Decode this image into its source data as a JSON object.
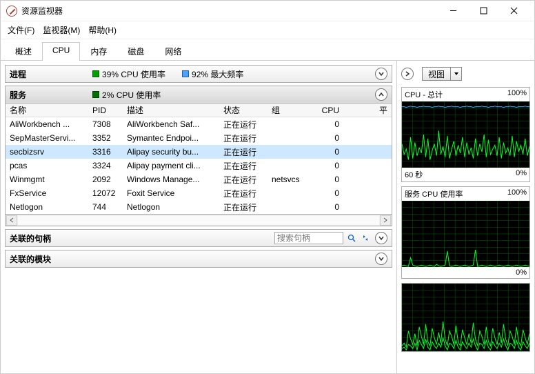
{
  "window": {
    "title": "资源监视器"
  },
  "menu": {
    "file": "文件(F)",
    "monitor": "监视器(M)",
    "help": "帮助(H)"
  },
  "tabs": {
    "overview": "概述",
    "cpu": "CPU",
    "memory": "内存",
    "disk": "磁盘",
    "network": "网络",
    "active": "cpu"
  },
  "process_panel": {
    "title": "进程",
    "cpu_text": "39% CPU 使用率",
    "freq_text": "92% 最大频率"
  },
  "services_panel": {
    "title": "服务",
    "cpu_text": "2% CPU 使用率",
    "columns": {
      "name": "名称",
      "pid": "PID",
      "desc": "描述",
      "status": "状态",
      "group": "组",
      "cpu": "CPU",
      "avg": "平"
    },
    "rows": [
      {
        "name": "AliWorkbench ...",
        "pid": "7308",
        "desc": "AliWorkbench Saf...",
        "status": "正在运行",
        "group": "",
        "cpu": "0"
      },
      {
        "name": "SepMasterServi...",
        "pid": "3352",
        "desc": "Symantec Endpoi...",
        "status": "正在运行",
        "group": "",
        "cpu": "0"
      },
      {
        "name": "secbizsrv",
        "pid": "3316",
        "desc": "Alipay security bu...",
        "status": "正在运行",
        "group": "",
        "cpu": "0",
        "selected": true
      },
      {
        "name": "pcas",
        "pid": "3324",
        "desc": "Alipay payment cli...",
        "status": "正在运行",
        "group": "",
        "cpu": "0"
      },
      {
        "name": "Winmgmt",
        "pid": "2092",
        "desc": "Windows Manage...",
        "status": "正在运行",
        "group": "netsvcs",
        "cpu": "0"
      },
      {
        "name": "FxService",
        "pid": "12072",
        "desc": "Foxit Service",
        "status": "正在运行",
        "group": "",
        "cpu": "0"
      },
      {
        "name": "Netlogon",
        "pid": "744",
        "desc": "Netlogon",
        "status": "正在运行",
        "group": "",
        "cpu": "0"
      }
    ]
  },
  "handles_panel": {
    "title": "关联的句柄",
    "search_placeholder": "搜索句柄"
  },
  "modules_panel": {
    "title": "关联的模块"
  },
  "right_controls": {
    "view_label": "视图"
  },
  "charts": {
    "cpu": {
      "title": "CPU - 总计",
      "value": "100%",
      "footer_left": "60 秒",
      "footer_right": "0%"
    },
    "svc": {
      "title": "服务 CPU 使用率",
      "value": "100%",
      "footer_right": "0%"
    }
  },
  "chart_data": [
    {
      "type": "line",
      "title": "CPU - 总计",
      "xlabel": "60 秒",
      "ylabel": "",
      "ylim": [
        0,
        100
      ],
      "series": [
        {
          "name": "cpu_usage",
          "color": "#00ff2a",
          "values": [
            36,
            20,
            28,
            12,
            46,
            14,
            38,
            18,
            30,
            22,
            50,
            16,
            44,
            12,
            26,
            36,
            18,
            56,
            20,
            32,
            16,
            48,
            14,
            28,
            40,
            18,
            34,
            22,
            46,
            16,
            38,
            20,
            30,
            14,
            44,
            18,
            36,
            24,
            50,
            16,
            42,
            20,
            28,
            34,
            18,
            46,
            14,
            38,
            22,
            30,
            18,
            48,
            16,
            40,
            24,
            34,
            20,
            44,
            18,
            32
          ]
        },
        {
          "name": "max_frequency",
          "color": "#3fa2ff",
          "values": [
            92,
            92,
            91,
            92,
            93,
            92,
            92,
            91,
            92,
            92,
            93,
            92,
            92,
            92,
            91,
            92,
            92,
            93,
            92,
            92,
            91,
            92,
            92,
            93,
            92,
            92,
            92,
            91,
            92,
            92,
            93,
            92,
            92,
            91,
            92,
            92,
            92,
            93,
            92,
            92,
            91,
            92,
            92,
            93,
            92,
            92,
            92,
            91,
            92,
            92,
            93,
            92,
            92,
            91,
            92,
            92,
            92,
            93,
            92,
            92
          ]
        }
      ]
    },
    {
      "type": "line",
      "title": "服务 CPU 使用率",
      "xlabel": "",
      "ylabel": "",
      "ylim": [
        0,
        100
      ],
      "series": [
        {
          "name": "service_cpu",
          "color": "#00ff2a",
          "values": [
            2,
            3,
            2,
            1,
            14,
            3,
            2,
            1,
            2,
            3,
            2,
            1,
            2,
            3,
            2,
            1,
            4,
            2,
            1,
            2,
            3,
            24,
            2,
            1,
            2,
            3,
            2,
            1,
            2,
            3,
            2,
            1,
            2,
            3,
            26,
            1,
            2,
            3,
            2,
            1,
            2,
            3,
            2,
            1,
            2,
            3,
            2,
            1,
            2,
            3,
            2,
            1,
            2,
            3,
            2,
            1,
            2,
            3,
            2,
            1
          ]
        }
      ]
    },
    {
      "type": "line",
      "title": "",
      "xlabel": "",
      "ylabel": "",
      "ylim": [
        0,
        100
      ],
      "series": [
        {
          "name": "line_a",
          "color": "#00ff2a",
          "values": [
            8,
            12,
            6,
            30,
            18,
            10,
            26,
            8,
            36,
            22,
            10,
            40,
            14,
            8,
            34,
            20,
            10,
            28,
            12,
            44,
            18,
            8,
            30,
            22,
            10,
            38,
            14,
            8,
            32,
            20,
            10,
            26,
            12,
            42,
            18,
            8,
            30,
            22,
            10,
            36,
            14,
            8,
            34,
            20,
            10,
            28,
            12,
            40,
            18,
            8,
            30,
            22,
            10,
            36,
            14,
            8,
            32,
            20,
            10,
            26
          ]
        },
        {
          "name": "line_b",
          "color": "#00ff2a",
          "values": [
            4,
            6,
            2,
            10,
            8,
            4,
            12,
            2,
            16,
            10,
            4,
            18,
            6,
            2,
            14,
            8,
            4,
            12,
            6,
            20,
            8,
            2,
            12,
            10,
            4,
            16,
            6,
            2,
            14,
            8,
            4,
            12,
            6,
            18,
            8,
            2,
            12,
            10,
            4,
            16,
            6,
            2,
            14,
            8,
            4,
            12,
            6,
            18,
            8,
            2,
            12,
            10,
            4,
            16,
            6,
            2,
            14,
            8,
            4,
            12
          ]
        }
      ]
    }
  ]
}
